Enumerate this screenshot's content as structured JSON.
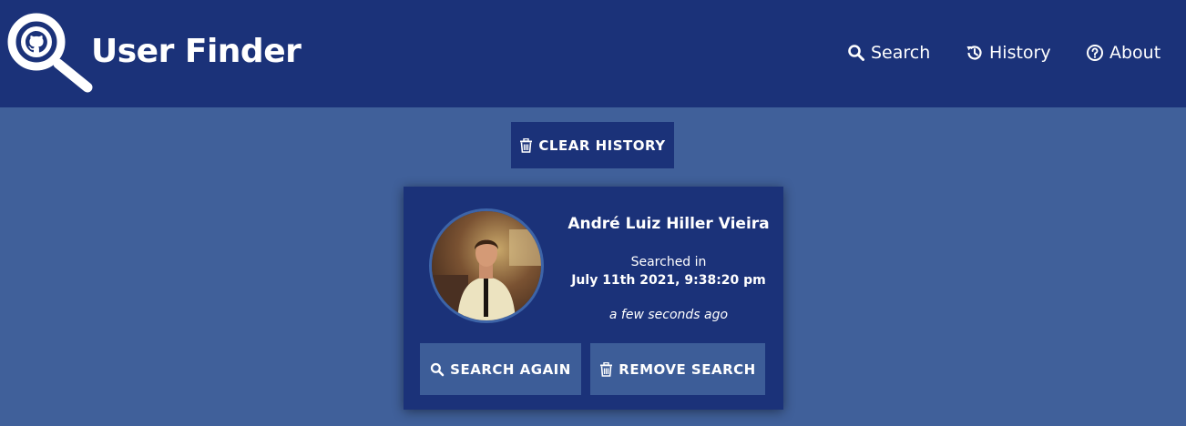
{
  "header": {
    "brand": "User Finder",
    "logo_icon": "github-magnifier-icon",
    "nav": [
      {
        "label": "Search",
        "icon": "search-icon"
      },
      {
        "label": "History",
        "icon": "history-icon"
      },
      {
        "label": "About",
        "icon": "question-circle-icon"
      }
    ]
  },
  "toolbar": {
    "clear_label": "CLEAR HISTORY",
    "clear_icon": "trash-icon"
  },
  "history": [
    {
      "name": "André Luiz Hiller Vieira",
      "searched_label": "Searched in",
      "searched_date": "July 11th 2021, 9:38:20 pm",
      "relative_time": "a few seconds ago",
      "search_again_label": "SEARCH AGAIN",
      "remove_label": "REMOVE SEARCH"
    }
  ],
  "colors": {
    "header_bg": "#1b3279",
    "page_bg": "#40609a",
    "card_bg": "#1b3279",
    "card_button_bg": "#3d5d98",
    "text": "#ffffff"
  }
}
